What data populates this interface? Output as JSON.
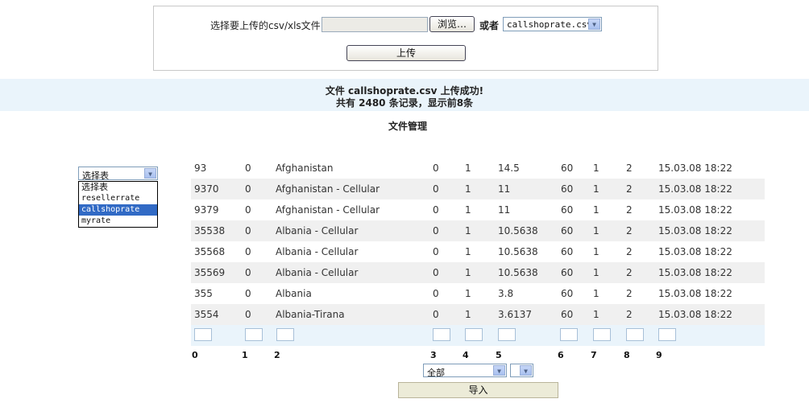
{
  "upload": {
    "label": "选择要上传的csv/xls文件:",
    "file_value": "",
    "browse_label": "浏览…",
    "or_label": "或者",
    "file_select_value": "callshoprate.csv",
    "upload_label": "上传"
  },
  "status": {
    "line1": "文件 callshoprate.csv 上传成功!",
    "line2": "共有 2480 条记录，显示前8条"
  },
  "section_title": "文件管理",
  "table_select": {
    "value": "选择表",
    "options": [
      "选择表",
      "resellerrate",
      "callshoprate",
      "myrate"
    ],
    "selected_index": 2
  },
  "rows": [
    [
      "93",
      "0",
      "Afghanistan",
      "0",
      "1",
      "14.5",
      "60",
      "1",
      "2",
      "15.03.08 18:22"
    ],
    [
      "9370",
      "0",
      "Afghanistan - Cellular",
      "0",
      "1",
      "11",
      "60",
      "1",
      "2",
      "15.03.08 18:22"
    ],
    [
      "9379",
      "0",
      "Afghanistan - Cellular",
      "0",
      "1",
      "11",
      "60",
      "1",
      "2",
      "15.03.08 18:22"
    ],
    [
      "35538",
      "0",
      "Albania - Cellular",
      "0",
      "1",
      "10.5638",
      "60",
      "1",
      "2",
      "15.03.08 18:22"
    ],
    [
      "35568",
      "0",
      "Albania - Cellular",
      "0",
      "1",
      "10.5638",
      "60",
      "1",
      "2",
      "15.03.08 18:22"
    ],
    [
      "35569",
      "0",
      "Albania - Cellular",
      "0",
      "1",
      "10.5638",
      "60",
      "1",
      "2",
      "15.03.08 18:22"
    ],
    [
      "355",
      "0",
      "Albania",
      "0",
      "1",
      "3.8",
      "60",
      "1",
      "2",
      "15.03.08 18:22"
    ],
    [
      "3554",
      "0",
      "Albania-Tirana",
      "0",
      "1",
      "3.6137",
      "60",
      "1",
      "2",
      "15.03.08 18:22"
    ]
  ],
  "column_indices": [
    "0",
    "1",
    "2",
    "3",
    "4",
    "5",
    "6",
    "7",
    "8",
    "9"
  ],
  "scope_select_value": "全部",
  "extra_select_value": "",
  "import_label": "导入",
  "colors": {
    "status_band": "#eaf4fb",
    "row_alt": "#f0f0f0",
    "selected_option": "#316ac5"
  }
}
